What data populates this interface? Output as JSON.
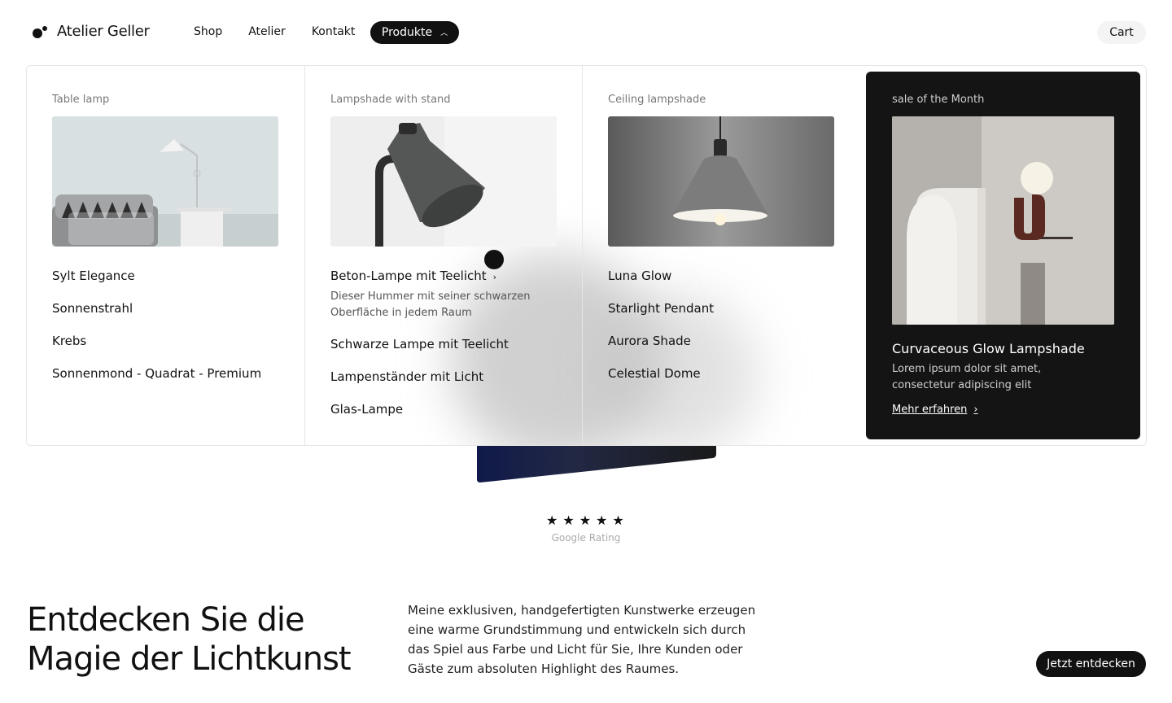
{
  "header": {
    "brand": "Atelier Geller",
    "nav": [
      "Shop",
      "Atelier",
      "Kontakt"
    ],
    "active_nav": "Produkte",
    "cart": "Cart"
  },
  "mega_menu": {
    "columns": [
      {
        "label": "Table lamp",
        "items": [
          "Sylt Elegance",
          "Sonnenstrahl",
          "Krebs",
          "Sonnenmond - Quadrat - Premium"
        ]
      },
      {
        "label": "Lampshade with stand",
        "items": [
          "Beton-Lampe mit Teelicht",
          "Schwarze Lampe mit Teelicht",
          "Lampenständer mit Licht",
          "Glas-Lampe"
        ],
        "highlight_desc": "Dieser Hummer mit seiner schwarzen Oberfläche in jedem Raum"
      },
      {
        "label": "Ceiling lampshade",
        "items": [
          "Luna Glow",
          "Starlight Pendant",
          "Aurora Shade",
          "Celestial Dome"
        ]
      }
    ],
    "promo": {
      "label": "sale of the Month",
      "title": "Curvaceous Glow Lampshade",
      "desc": "Lorem ipsum dolor sit amet, consectetur adipiscing elit",
      "link": "Mehr erfahren"
    }
  },
  "rating": {
    "stars": 5,
    "label": "Google Rating"
  },
  "section": {
    "headline": "Entdecken Sie die Magie der Lichtkunst",
    "body": "Meine exklusiven, handgefertigten Kunstwerke erzeugen eine warme Grundstimmung und entwickeln sich durch das Spiel aus Farbe und Licht für Sie, Ihre Kunden oder Gäste zum absoluten Highlight des Raumes.",
    "cta": "Jetzt entdecken"
  }
}
